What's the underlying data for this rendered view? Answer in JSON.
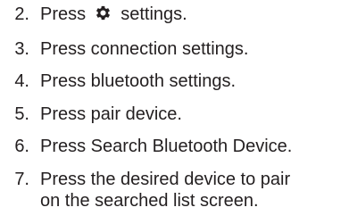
{
  "steps": [
    {
      "number": "2.",
      "text_before_icon": "Press",
      "icon": "gear-icon",
      "text_after_icon": "settings."
    },
    {
      "number": "3.",
      "text": "Press connection settings."
    },
    {
      "number": "4.",
      "text": "Press bluetooth settings."
    },
    {
      "number": "5.",
      "text": "Press pair device."
    },
    {
      "number": "6.",
      "text": "Press Search Bluetooth Device."
    },
    {
      "number": "7.",
      "text_line1": "Press the desired device to pair",
      "text_line2": "on the searched list screen."
    }
  ]
}
